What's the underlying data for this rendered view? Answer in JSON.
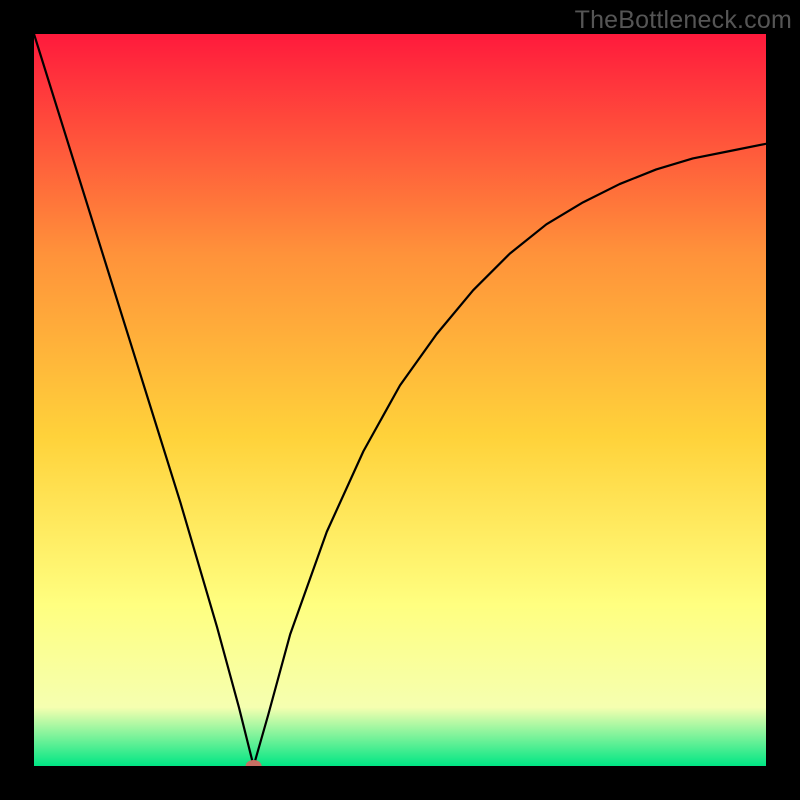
{
  "watermark": "TheBottleneck.com",
  "chart_data": {
    "type": "line",
    "title": "",
    "xlabel": "",
    "ylabel": "",
    "xlim": [
      0,
      100
    ],
    "ylim": [
      0,
      100
    ],
    "grid": false,
    "legend": false,
    "background_gradient": {
      "top": "#ff1a3c",
      "mid_upper": "#ff923a",
      "mid": "#ffd23a",
      "mid_lower": "#ffff80",
      "near_bottom": "#f5ffb0",
      "bottom": "#00e684"
    },
    "marker": {
      "x": 30,
      "y": 0,
      "color": "#c77064"
    },
    "series": [
      {
        "name": "curve",
        "x": [
          0,
          5,
          10,
          15,
          20,
          25,
          28,
          30,
          32,
          35,
          40,
          45,
          50,
          55,
          60,
          65,
          70,
          75,
          80,
          85,
          90,
          95,
          100
        ],
        "values": [
          100,
          84,
          68,
          52,
          36,
          19,
          8,
          0,
          7,
          18,
          32,
          43,
          52,
          59,
          65,
          70,
          74,
          77,
          79.5,
          81.5,
          83,
          84,
          85
        ]
      }
    ]
  }
}
